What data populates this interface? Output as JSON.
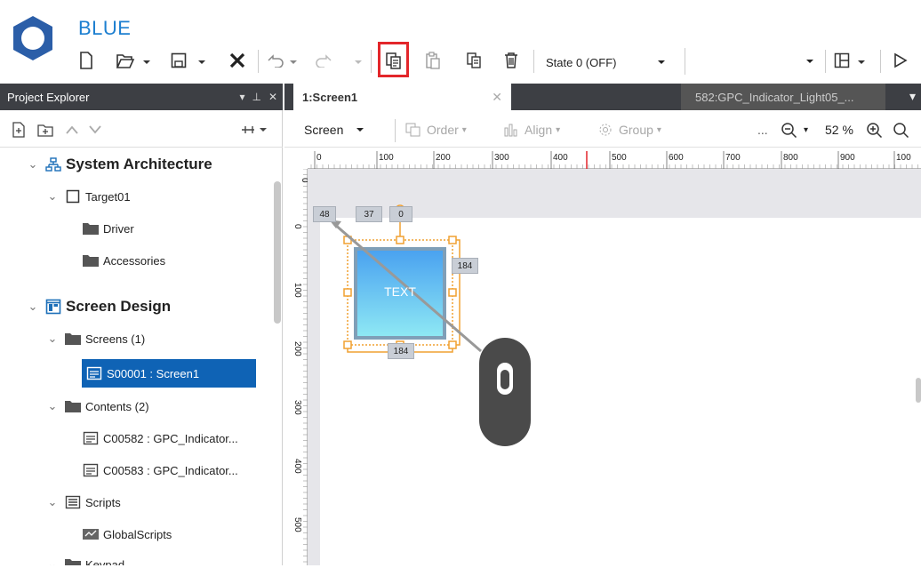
{
  "app": {
    "title": "BLUE"
  },
  "toolbar": {
    "state_label": "State 0 (OFF)",
    "icons": [
      "new-file-icon",
      "open-folder-icon",
      "save-icon",
      "close-icon",
      "undo-icon",
      "redo-icon",
      "copy-icon",
      "paste-icon",
      "duplicate-icon",
      "delete-icon",
      "layout-icon",
      "play-icon"
    ]
  },
  "explorer": {
    "title": "Project Explorer",
    "tree": {
      "system_architecture": "System Architecture",
      "target": "Target01",
      "driver": "Driver",
      "accessories": "Accessories",
      "screen_design": "Screen Design",
      "screens": "Screens (1)",
      "screen1": "S00001 : Screen1",
      "contents": "Contents (2)",
      "content1": "C00582 : GPC_Indicator...",
      "content2": "C00583 : GPC_Indicator...",
      "scripts": "Scripts",
      "global_scripts": "GlobalScripts",
      "keypad": "Keypad"
    }
  },
  "tabs": {
    "active": "1:Screen1",
    "other": "582:GPC_Indicator_Light05_..."
  },
  "screen_toolbar": {
    "screen": "Screen",
    "order": "Order",
    "align": "Align",
    "group": "Group",
    "ellipsis": "...",
    "zoom": "52 %"
  },
  "ruler": {
    "h_ticks": [
      "0",
      "100",
      "200",
      "300",
      "400",
      "500",
      "600",
      "700",
      "800",
      "900",
      "100"
    ],
    "v_ticks": [
      "0",
      "100",
      "200",
      "300",
      "400",
      "500"
    ],
    "v_top": "0"
  },
  "canvas": {
    "widget_text": "TEXT",
    "dim_x": "48",
    "dim_y": "37",
    "dim_rot": "0",
    "dim_height": "184",
    "dim_width": "184"
  },
  "colors": {
    "accent": "#0f63b5",
    "brand": "#1d7fd0",
    "highlight": "#e3262a",
    "selection": "#f0a030"
  }
}
